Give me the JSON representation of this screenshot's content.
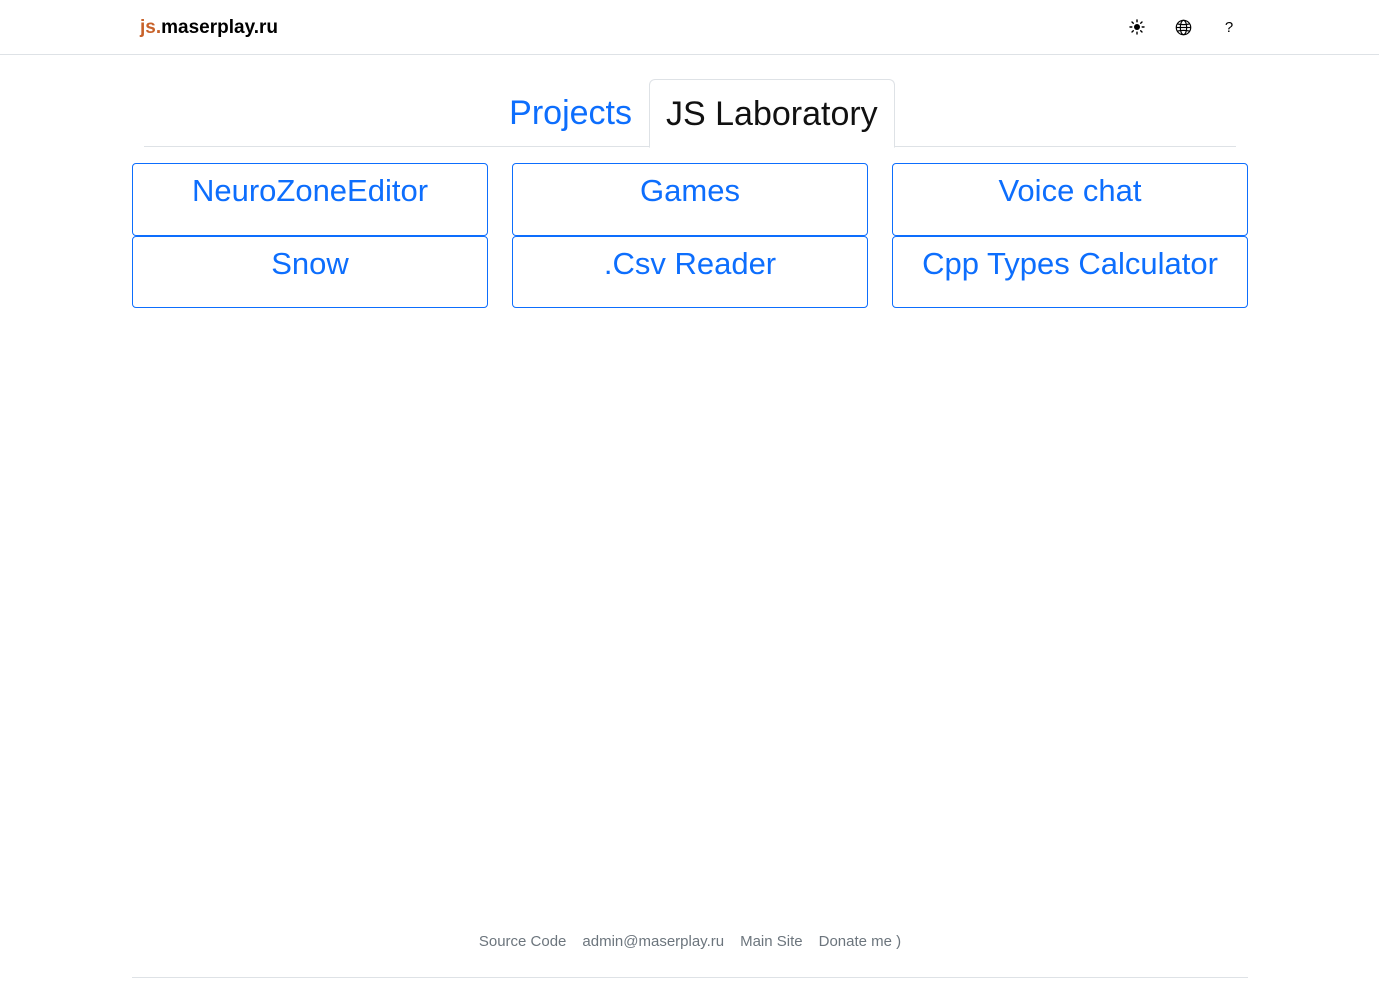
{
  "header": {
    "brand_prefix": "js.",
    "brand_name": "maserplay.ru",
    "icons": [
      {
        "name": "sun-icon",
        "glyph": "☀"
      },
      {
        "name": "globe-icon",
        "glyph": "🌐"
      },
      {
        "name": "help-icon",
        "glyph": "?"
      }
    ]
  },
  "tabs": [
    {
      "label": "Projects",
      "active": false
    },
    {
      "label": "JS Laboratory",
      "active": true
    }
  ],
  "cards": [
    {
      "label": "NeuroZoneEditor"
    },
    {
      "label": "Games"
    },
    {
      "label": "Voice chat"
    },
    {
      "label": "Snow"
    },
    {
      "label": ".Csv Reader"
    },
    {
      "label": "Cpp Types Calculator"
    }
  ],
  "footer": {
    "links": [
      "Source Code",
      "admin@maserplay.ru",
      "Main Site",
      "Donate me )"
    ]
  },
  "colors": {
    "accent": "#0d6efd",
    "brand_prefix": "#c8622a",
    "muted": "#6c757d",
    "border": "#dee2e6"
  }
}
